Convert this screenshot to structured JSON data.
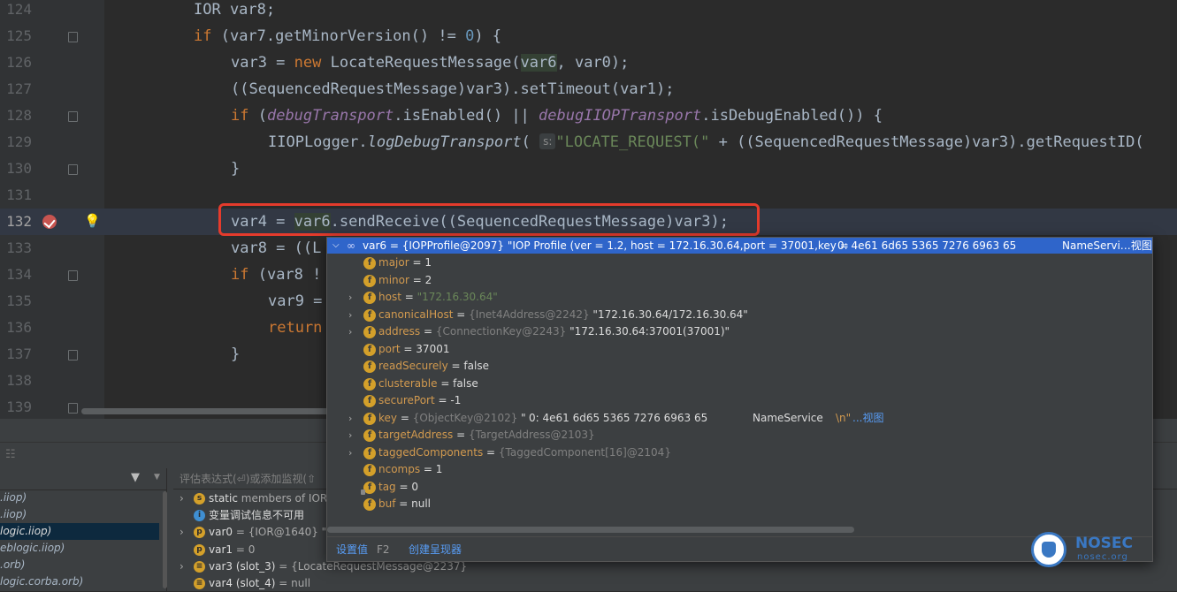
{
  "editor": {
    "line_numbers": [
      "124",
      "125",
      "126",
      "127",
      "128",
      "129",
      "130",
      "131",
      "132",
      "133",
      "134",
      "135",
      "136",
      "137",
      "138",
      "139"
    ],
    "current_line": "132",
    "param_hint": "s:"
  },
  "popup": {
    "header": {
      "name": "var6",
      "value": " = {IOPProfile@2097} \"IOP Profile (ver = 1.2, host = 172.16.30.64,port = 37001,key =",
      "bytes": "0: 4e61 6d65 5365 7276 6963 65",
      "tail": "NameServi…视图"
    },
    "fields": [
      {
        "name": "major",
        "value": " = 1",
        "icon": "f",
        "expandable": false
      },
      {
        "name": "minor",
        "value": " = 2",
        "icon": "f",
        "expandable": false
      },
      {
        "name": "host",
        "value": " = ",
        "str": "\"172.16.30.64\"",
        "icon": "f",
        "expandable": true
      },
      {
        "name": "canonicalHost",
        "value": " = ",
        "ref": "{Inet4Address@2242}",
        "str2": " \"172.16.30.64/172.16.30.64\"",
        "icon": "f",
        "expandable": true
      },
      {
        "name": "address",
        "value": " = ",
        "ref": "{ConnectionKey@2243}",
        "str2": " \"172.16.30.64:37001(37001)\"",
        "icon": "f",
        "expandable": true
      },
      {
        "name": "port",
        "value": " = 37001",
        "icon": "f",
        "expandable": false
      },
      {
        "name": "readSecurely",
        "value": " = false",
        "icon": "f",
        "expandable": false
      },
      {
        "name": "clusterable",
        "value": " = false",
        "icon": "f",
        "expandable": false
      },
      {
        "name": "securePort",
        "value": " = -1",
        "icon": "f",
        "expandable": false
      },
      {
        "name": "key",
        "value": " = ",
        "ref": "{ObjectKey@2102}",
        "str2": " \"",
        "bytes": "0: 4e61 6d65 5365 7276 6963 65",
        "svc": "NameService",
        "nl": "\\n\"",
        "link": " ...视图",
        "icon": "f",
        "expandable": true
      },
      {
        "name": "targetAddress",
        "value": " = ",
        "ref": "{TargetAddress@2103}",
        "icon": "f",
        "expandable": true
      },
      {
        "name": "taggedComponents",
        "value": " = ",
        "ref": "{TaggedComponent[16]@2104}",
        "icon": "f",
        "expandable": true
      },
      {
        "name": "ncomps",
        "value": " = 1",
        "icon": "f",
        "expandable": false
      },
      {
        "name": "tag",
        "value": " = 0",
        "icon": "f",
        "expandable": false
      },
      {
        "name": "buf",
        "value": " = null",
        "icon": "f",
        "expandable": false
      }
    ],
    "footer": {
      "set_value": "设置值",
      "shortcut": "F2",
      "create_renderer": "创建呈现器"
    }
  },
  "debugger": {
    "eval_placeholder": "评估表达式(⏎)或添加监视(⇧",
    "frames": [
      ".iiop)",
      ".iiop)",
      "logic.iiop)",
      "eblogic.iiop)",
      ".orb)",
      "logic.corba.orb)"
    ],
    "selected_frame": 2,
    "vars": [
      {
        "badge": "s",
        "color": "#d4a02a",
        "expand": "›",
        "name": "static",
        "rest": " members of IOR"
      },
      {
        "badge": "i",
        "color": "#3f8fd2",
        "expand": "",
        "name": "变量调试信息不可用",
        "rest": ""
      },
      {
        "badge": "p",
        "color": "#d4a02a",
        "expand": "›",
        "name": "var0",
        "rest": " = {IOR@1640} \"w"
      },
      {
        "badge": "p",
        "color": "#d4a02a",
        "expand": "",
        "name": "var1",
        "rest": " = 0"
      },
      {
        "badge": "≡",
        "color": "#d4a02a",
        "expand": "›",
        "name": "var3 (slot_3)",
        "rest": " = {LocateRequestMessage@2237}"
      },
      {
        "badge": "≡",
        "color": "#d4a02a",
        "expand": "",
        "name": "var4 (slot_4)",
        "rest": " = null"
      }
    ]
  },
  "watermark": {
    "brand": "NOSEC",
    "site": "nosec.org"
  },
  "colors": {
    "accent": "#2f65ca",
    "highlight_border": "#e53b2c"
  }
}
